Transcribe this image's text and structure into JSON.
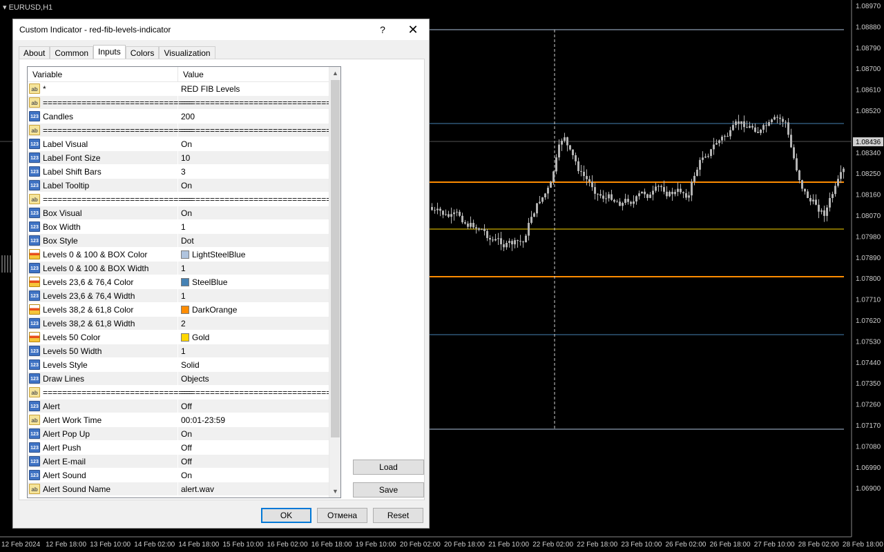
{
  "chart": {
    "symbol": "EURUSD,H1",
    "price_labels": [
      "1.08970",
      "1.08880",
      "1.08790",
      "1.08700",
      "1.08610",
      "1.08520",
      "1.08436",
      "1.08340",
      "1.08250",
      "1.08160",
      "1.08070",
      "1.07980",
      "1.07890",
      "1.07800",
      "1.07710",
      "1.07620",
      "1.07530",
      "1.07440",
      "1.07350",
      "1.07260",
      "1.07170",
      "1.07080",
      "1.06990",
      "1.06900"
    ],
    "current_price": "1.08436",
    "time_labels": [
      "12 Feb 2024",
      "12 Feb 18:00",
      "13 Feb 10:00",
      "14 Feb 02:00",
      "14 Feb 18:00",
      "15 Feb 10:00",
      "16 Feb 02:00",
      "16 Feb 18:00",
      "19 Feb 10:00",
      "20 Feb 02:00",
      "20 Feb 18:00",
      "21 Feb 10:00",
      "22 Feb 02:00",
      "22 Feb 18:00",
      "23 Feb 10:00",
      "26 Feb 02:00",
      "26 Feb 18:00",
      "27 Feb 10:00",
      "28 Feb 02:00",
      "28 Feb 18:00"
    ],
    "colors": {
      "background": "#000000",
      "candle": "#b4b4b4",
      "level_0_100": "#b0c4de",
      "level_236_764": "#4682b4",
      "level_382_618": "#ff8c00",
      "level_50": "#ffd700",
      "axis_text": "#cfcfcf"
    }
  },
  "dialog": {
    "title": "Custom Indicator - red-fib-levels-indicator",
    "help_label": "?",
    "close_label": "✕",
    "tabs": [
      "About",
      "Common",
      "Inputs",
      "Colors",
      "Visualization"
    ],
    "active_tab": "Inputs",
    "grid": {
      "col_variable": "Variable",
      "col_value": "Value",
      "rows": [
        {
          "type": "ab",
          "var": "*",
          "val": "RED FIB Levels"
        },
        {
          "type": "ab",
          "var": "===============================",
          "val": "================================"
        },
        {
          "type": "num",
          "var": "Candles",
          "val": "200"
        },
        {
          "type": "ab",
          "var": "===============================",
          "val": "================================"
        },
        {
          "type": "num",
          "var": "Label Visual",
          "val": "On"
        },
        {
          "type": "num",
          "var": "Label Font Size",
          "val": "10"
        },
        {
          "type": "num",
          "var": "Label Shift Bars",
          "val": "3"
        },
        {
          "type": "num",
          "var": "Label Tooltip",
          "val": "On"
        },
        {
          "type": "ab",
          "var": "===============================",
          "val": "================================"
        },
        {
          "type": "num",
          "var": "Box Visual",
          "val": "On"
        },
        {
          "type": "num",
          "var": "Box Width",
          "val": "1"
        },
        {
          "type": "num",
          "var": "Box Style",
          "val": "Dot"
        },
        {
          "type": "col",
          "var": "Levels 0 & 100 & BOX Color",
          "val": "LightSteelBlue",
          "swatch": "#b0c4de"
        },
        {
          "type": "num",
          "var": "Levels 0 & 100 & BOX Width",
          "val": "1"
        },
        {
          "type": "col",
          "var": "Levels 23,6 & 76,4 Color",
          "val": "SteelBlue",
          "swatch": "#4682b4"
        },
        {
          "type": "num",
          "var": "Levels 23,6 & 76,4 Width",
          "val": "1"
        },
        {
          "type": "col",
          "var": "Levels 38,2 & 61,8 Color",
          "val": "DarkOrange",
          "swatch": "#ff8c00"
        },
        {
          "type": "num",
          "var": "Levels 38,2 & 61,8 Width",
          "val": "2"
        },
        {
          "type": "col",
          "var": "Levels 50 Color",
          "val": "Gold",
          "swatch": "#ffd700"
        },
        {
          "type": "num",
          "var": "Levels 50 Width",
          "val": "1"
        },
        {
          "type": "num",
          "var": "Levels Style",
          "val": "Solid"
        },
        {
          "type": "num",
          "var": "Draw Lines",
          "val": "Objects"
        },
        {
          "type": "ab",
          "var": "===============================",
          "val": "================================"
        },
        {
          "type": "num",
          "var": "Alert",
          "val": "Off"
        },
        {
          "type": "ab",
          "var": "Alert Work Time",
          "val": "00:01-23:59"
        },
        {
          "type": "num",
          "var": "Alert Pop Up",
          "val": "On"
        },
        {
          "type": "num",
          "var": "Alert Push",
          "val": "Off"
        },
        {
          "type": "num",
          "var": "Alert E-mail",
          "val": "Off"
        },
        {
          "type": "num",
          "var": "Alert Sound",
          "val": "On"
        },
        {
          "type": "ab",
          "var": "Alert Sound Name",
          "val": "alert.wav"
        }
      ]
    },
    "icons": {
      "ab": "ab",
      "num": "123",
      "col": ""
    },
    "load_label": "Load",
    "save_label": "Save",
    "ok_label": "OK",
    "cancel_label": "Отмена",
    "reset_label": "Reset"
  }
}
